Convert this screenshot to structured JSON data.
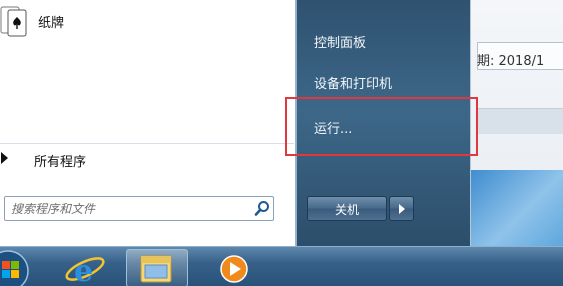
{
  "start_menu": {
    "pinned": [
      {
        "label": "纸牌",
        "icon": "solitaire-cards-icon"
      }
    ],
    "all_programs_label": "所有程序",
    "search": {
      "placeholder": "搜索程序和文件",
      "icon": "search-icon"
    },
    "right_items": [
      {
        "label": "控制面板"
      },
      {
        "label": "设备和打印机"
      },
      {
        "label": "运行..."
      }
    ],
    "shutdown_label": "关机",
    "highlight_color": "#e0393d"
  },
  "background_window": {
    "date_text": "期: 2018/1"
  },
  "taskbar": {
    "items": [
      {
        "name": "start-orb",
        "icon": "windows-orb-icon"
      },
      {
        "name": "internet-explorer",
        "icon": "ie-icon"
      },
      {
        "name": "file-explorer",
        "icon": "folder-icon"
      },
      {
        "name": "media-player",
        "icon": "media-player-icon"
      }
    ]
  }
}
